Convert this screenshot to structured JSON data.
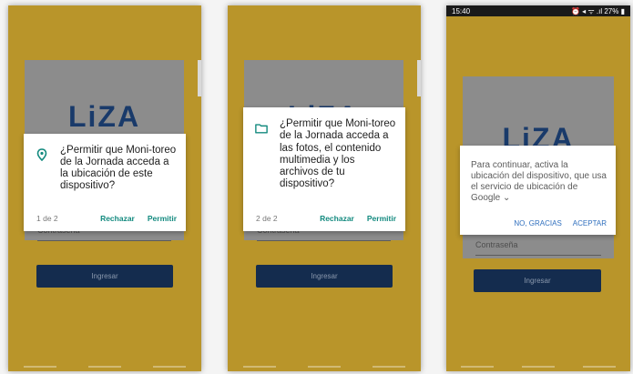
{
  "login": {
    "logo": "LiZA",
    "password_placeholder": "Contraseña",
    "submit_label": "Ingresar"
  },
  "status_bar": {
    "time": "15:40",
    "right": "⏰ ◂ ᯤ .ıl 27% ▮"
  },
  "dialogs": [
    {
      "text": "¿Permitir que Moni-toreo de la Jornada acceda a la ubicación de este dispositivo?",
      "counter": "1 de 2",
      "deny_label": "Rechazar",
      "allow_label": "Permitir",
      "icon": "location-pin-icon"
    },
    {
      "text": "¿Permitir que Moni-toreo de la Jornada acceda a las fotos, el contenido multimedia y los archivos de tu dispositivo?",
      "counter": "2 de 2",
      "deny_label": "Rechazar",
      "allow_label": "Permitir",
      "icon": "folder-icon"
    },
    {
      "text": "Para continuar, activa la ubicación del dispositivo, que usa el servicio de ubicación de Google ⌄",
      "decline_label": "NO, GRACIAS",
      "accept_label": "ACEPTAR"
    }
  ],
  "colors": {
    "background": "#b9952a",
    "accent": "#138a7f",
    "button": "#142c4e",
    "link_blue": "#2f6fbe"
  }
}
